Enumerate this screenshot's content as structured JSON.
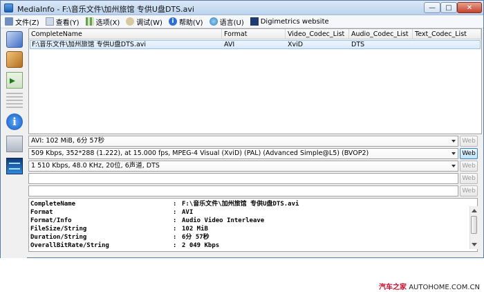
{
  "titlebar": {
    "title": "MediaInfo - F:\\音乐文件\\加州旅馆 专供U盘DTS.avi",
    "minimize_glyph": "—",
    "maximize_glyph": "□",
    "close_glyph": "✕"
  },
  "menu": {
    "items": [
      {
        "label": "文件(Z)",
        "icon": "file-icon"
      },
      {
        "label": "查看(Y)",
        "icon": "view-icon"
      },
      {
        "label": "选项(X)",
        "icon": "options-icon"
      },
      {
        "label": "调试(W)",
        "icon": "debug-icon"
      },
      {
        "label": "帮助(V)",
        "icon": "help-icon"
      },
      {
        "label": "语言(U)",
        "icon": "language-icon"
      },
      {
        "label": "Digimetrics website",
        "icon": "digimetrics-icon"
      }
    ]
  },
  "sidebar": {
    "icons": [
      "easy-view-icon",
      "sheet-view-icon",
      "export-icon",
      "tree-view-icon",
      "info-icon",
      "html-view-icon",
      "digimetrics-wave-icon"
    ],
    "info_glyph": "i"
  },
  "list": {
    "columns": [
      "CompleteName",
      "Format",
      "Video_Codec_List",
      "Audio_Codec_List",
      "Text_Codec_List"
    ],
    "rows": [
      [
        "F:\\音乐文件\\加州旅馆 专供U盘DTS.avi",
        "AVI",
        "XviD",
        "DTS",
        ""
      ]
    ]
  },
  "streams": [
    {
      "text": "AVI: 102 MiB, 6分 57秒",
      "combo": true,
      "web_active": false
    },
    {
      "text": "509 Kbps, 352*288 (1.222), at 15.000 fps, MPEG-4 Visual (XviD) (PAL) (Advanced Simple@L5) (BVOP2)",
      "combo": true,
      "web_active": true
    },
    {
      "text": "1 510 Kbps, 48.0 KHz, 20位, 6声道, DTS",
      "combo": true,
      "web_active": false
    },
    {
      "text": "",
      "combo": false,
      "web_active": false
    },
    {
      "text": "",
      "combo": false,
      "web_active": false
    }
  ],
  "web_label": "Web",
  "details": [
    {
      "key": "CompleteName",
      "value": "F:\\音乐文件\\加州旅馆 专供U盘DTS.avi"
    },
    {
      "key": "Format",
      "value": "AVI"
    },
    {
      "key": "Format/Info",
      "value": "Audio Video Interleave"
    },
    {
      "key": "FileSize/String",
      "value": "102 MiB"
    },
    {
      "key": "Duration/String",
      "value": "6分 57秒"
    },
    {
      "key": "OverallBitRate/String",
      "value": "2 049 Kbps"
    }
  ],
  "details_separator": ":",
  "watermark": {
    "brand": "汽车之家",
    "site": "AUTOHOME.COM.CN"
  }
}
